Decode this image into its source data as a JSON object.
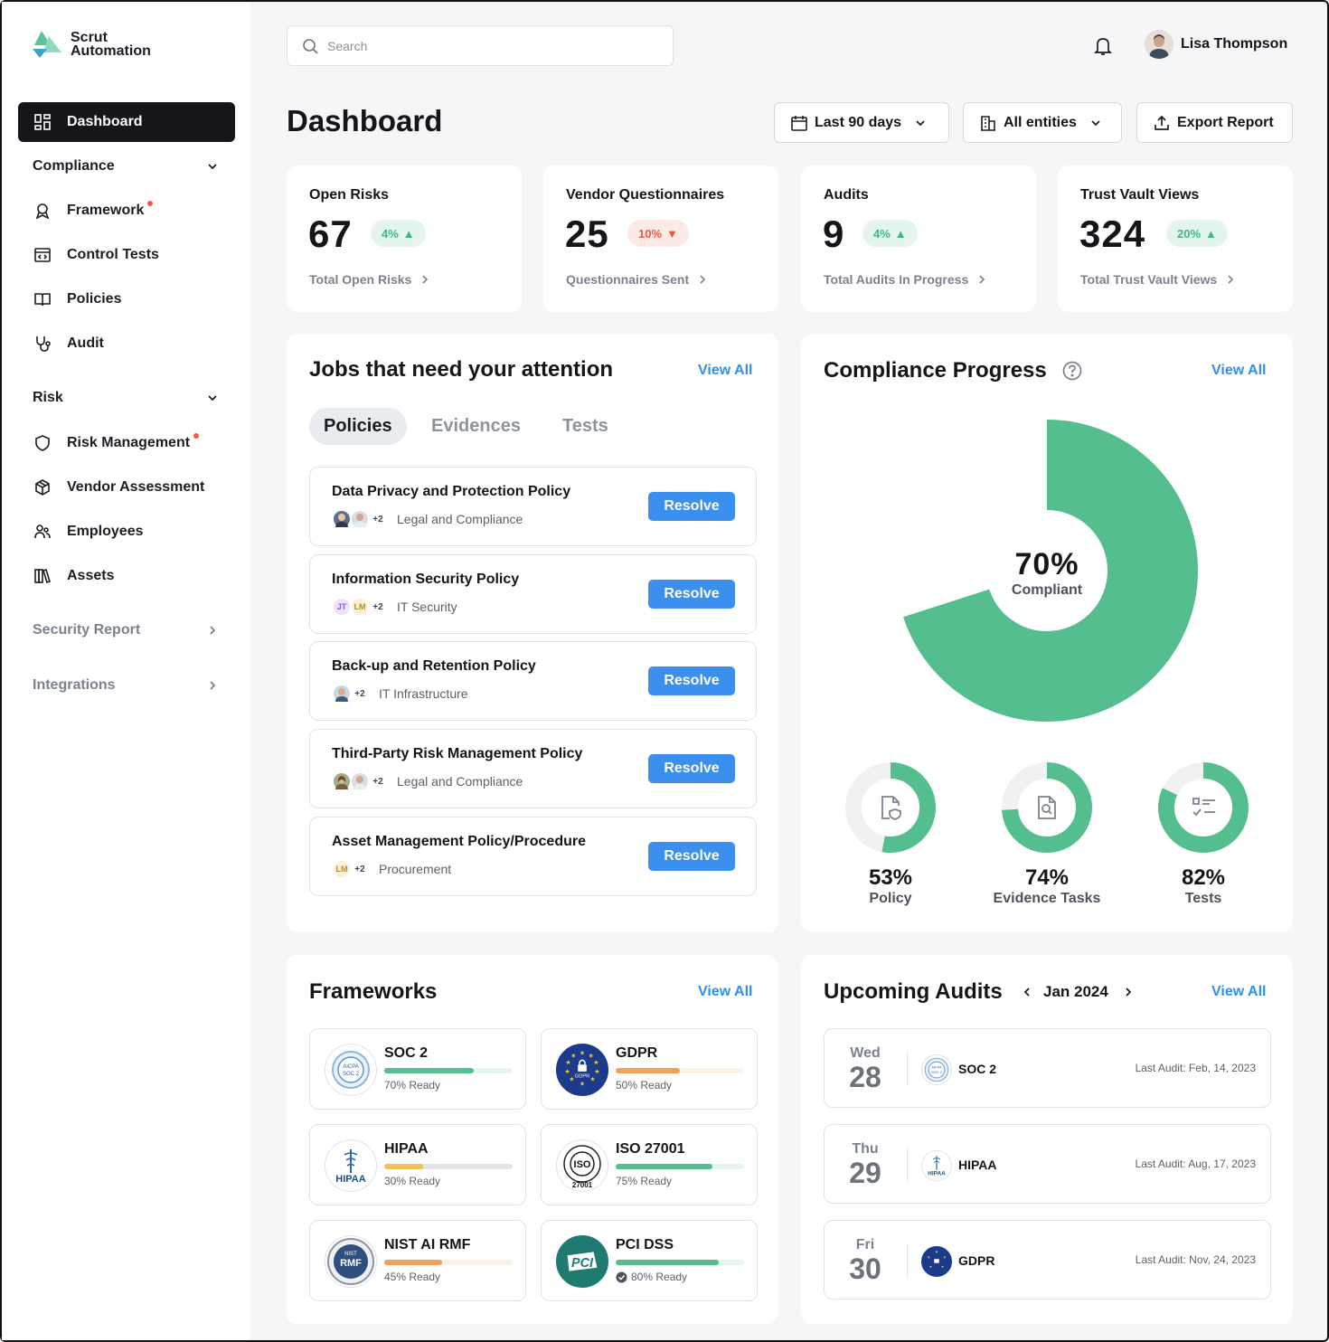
{
  "brand": {
    "line1": "Scrut",
    "line2": "Automation",
    "color": "#5cc39f"
  },
  "search": {
    "placeholder": "Search"
  },
  "user": {
    "name": "Lisa Thompson"
  },
  "sidebar": {
    "dashboard": "Dashboard",
    "compliance": "Compliance",
    "compliance_items": [
      "Framework",
      "Control Tests",
      "Policies",
      "Audit"
    ],
    "risk": "Risk",
    "risk_items": [
      "Risk Management",
      "Vendor Assessment",
      "Employees",
      "Assets"
    ],
    "security_report": "Security Report",
    "integrations": "Integrations"
  },
  "header": {
    "title": "Dashboard",
    "range": "Last 90 days",
    "entities": "All entities",
    "export": "Export Report"
  },
  "stats": [
    {
      "title": "Open Risks",
      "value": "67",
      "change": "4%",
      "trend": "up",
      "link": "Total Open Risks"
    },
    {
      "title": "Vendor Questionnaires",
      "value": "25",
      "change": "10%",
      "trend": "down",
      "link": "Questionnaires Sent"
    },
    {
      "title": "Audits",
      "value": "9",
      "change": "4%",
      "trend": "up",
      "link": "Total Audits In Progress"
    },
    {
      "title": "Trust Vault Views",
      "value": "324",
      "change": "20%",
      "trend": "up",
      "link": "Total Trust Vault Views"
    }
  ],
  "jobs": {
    "title": "Jobs that need your attention",
    "view_all": "View All",
    "tabs": [
      "Policies",
      "Evidences",
      "Tests"
    ],
    "active_tab": "Policies",
    "action_label": "Resolve",
    "items": [
      {
        "title": "Data Privacy and Protection Policy",
        "more": "+2",
        "team": "Legal and Compliance"
      },
      {
        "title": "Information Security Policy",
        "initials": [
          "JT",
          "LM"
        ],
        "more": "+2",
        "team": "IT Security"
      },
      {
        "title": "Back-up and Retention Policy",
        "more": "+2",
        "team": "IT Infrastructure"
      },
      {
        "title": "Third-Party Risk Management Policy",
        "more": "+2",
        "team": "Legal and Compliance"
      },
      {
        "title": "Asset Management Policy/Procedure",
        "initials": [
          "LM"
        ],
        "more": "+2",
        "team": "Procurement"
      }
    ]
  },
  "compliance": {
    "title": "Compliance Progress",
    "view_all": "View All",
    "overall": {
      "value": 70,
      "label": "70%",
      "caption": "Compliant"
    },
    "breakdown": [
      {
        "name": "Policy",
        "value": 53,
        "label": "53%",
        "icon": "policy-icon"
      },
      {
        "name": "Evidence Tasks",
        "value": 74,
        "label": "74%",
        "icon": "evidence-icon"
      },
      {
        "name": "Tests",
        "value": 82,
        "label": "82%",
        "icon": "tests-icon"
      }
    ],
    "color": "#55be8f",
    "track_color": "#f0f1f3"
  },
  "frameworks": {
    "title": "Frameworks",
    "view_all": "View All",
    "items": [
      {
        "name": "SOC 2",
        "ready": 70,
        "ready_label": "70% Ready",
        "color": "#55be8f",
        "track": "#e4f6ee",
        "logo": "AICPA SOC 2"
      },
      {
        "name": "GDPR",
        "ready": 50,
        "ready_label": "50% Ready",
        "color": "#f2a05a",
        "track": "#fdf1e6",
        "logo": "GDPR"
      },
      {
        "name": "HIPAA",
        "ready": 30,
        "ready_label": "30% Ready",
        "color": "#f2c35a",
        "track": "#e3e5e9",
        "logo": "HIPAA"
      },
      {
        "name": "ISO 27001",
        "ready": 75,
        "ready_label": "75% Ready",
        "color": "#55be8f",
        "track": "#e4f6ee",
        "logo": "ISO 27001"
      },
      {
        "name": "NIST AI RMF",
        "ready": 45,
        "ready_label": "45% Ready",
        "color": "#f2a05a",
        "track": "#fdf1e6",
        "logo": "NIST RMF"
      },
      {
        "name": "PCI DSS",
        "ready": 80,
        "ready_label": "80% Ready",
        "color": "#55be8f",
        "track": "#e4f6ee",
        "logo": "PCI",
        "verified": true
      }
    ]
  },
  "audits": {
    "title": "Upcoming Audits",
    "month": "Jan 2024",
    "view_all": "View All",
    "items": [
      {
        "day": "Wed",
        "date": "28",
        "name": "SOC 2",
        "last": "Last Audit: Feb, 14, 2023",
        "logo": "AICPA SOC 2"
      },
      {
        "day": "Thu",
        "date": "29",
        "name": "HIPAA",
        "last": "Last Audit: Aug, 17, 2023",
        "logo": "HIPAA"
      },
      {
        "day": "Fri",
        "date": "30",
        "name": "GDPR",
        "last": "Last Audit: Nov, 24, 2023",
        "logo": "GDPR"
      }
    ]
  }
}
